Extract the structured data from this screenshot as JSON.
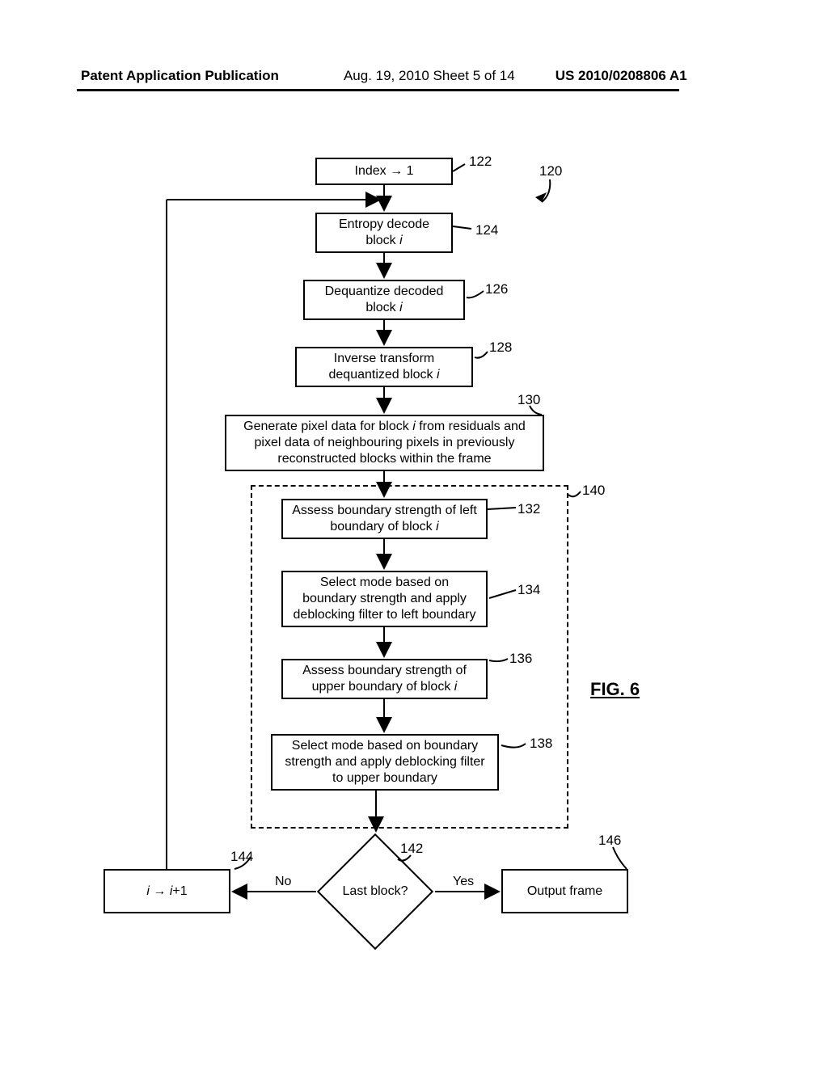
{
  "header": {
    "left": "Patent Application Publication",
    "mid": "Aug. 19, 2010  Sheet 5 of 14",
    "right": "US 2010/0208806 A1"
  },
  "refs": {
    "r120": "120",
    "r122": "122",
    "r124": "124",
    "r126": "126",
    "r128": "128",
    "r130": "130",
    "r132": "132",
    "r134": "134",
    "r136": "136",
    "r138": "138",
    "r140": "140",
    "r142": "142",
    "r144": "144",
    "r146": "146"
  },
  "boxes": {
    "b122": "Index → 1",
    "b124a": "Entropy decode",
    "b124b": "block ",
    "b126a": "Dequantize decoded",
    "b126b": "block ",
    "b128a": "Inverse transform",
    "b128b": "dequantized block ",
    "b130a": "Generate pixel data for block ",
    "b130b": " from residuals and",
    "b130c": "pixel data of neighbouring pixels in previously",
    "b130d": "reconstructed blocks within the frame",
    "b132a": "Assess boundary strength of left",
    "b132b": "boundary of block ",
    "b134a": "Select mode based on",
    "b134b": "boundary strength and apply",
    "b134c": "deblocking filter to left boundary",
    "b136a": "Assess boundary strength of",
    "b136b": "upper boundary of block ",
    "b138a": "Select mode based on boundary",
    "b138b": "strength and apply deblocking filter",
    "b138c": "to upper boundary",
    "b144a": "i",
    "b144b": " → ",
    "b144c": "i",
    "b144d": "+1",
    "b146": "Output frame"
  },
  "decision": {
    "q": "Last block?",
    "no": "No",
    "yes": "Yes"
  },
  "fig": "FIG. 6",
  "i": "i"
}
